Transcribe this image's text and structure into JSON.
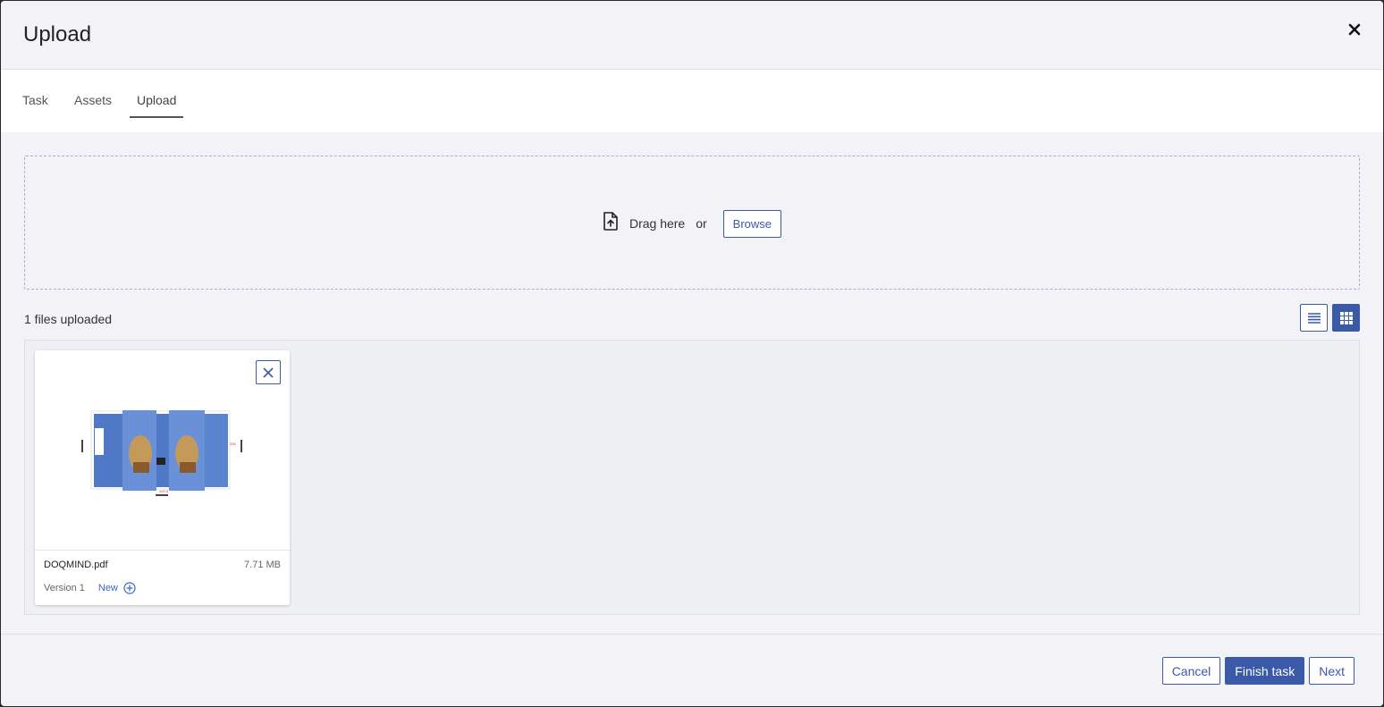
{
  "modal": {
    "title": "Upload"
  },
  "tabs": [
    {
      "label": "Task"
    },
    {
      "label": "Assets"
    },
    {
      "label": "Upload"
    }
  ],
  "dropzone": {
    "drag_text": "Drag here",
    "or_text": "or",
    "browse_label": "Browse"
  },
  "files": {
    "count_text": "1 files uploaded",
    "items": [
      {
        "name": "DOQMIND.pdf",
        "size": "7.71 MB",
        "version": "Version 1",
        "new_label": "New"
      }
    ]
  },
  "footer": {
    "cancel_label": "Cancel",
    "finish_label": "Finish task",
    "next_label": "Next"
  },
  "colors": {
    "accent": "#3a5aa8",
    "link": "#3a68c4",
    "background": "#f3f3f7"
  }
}
